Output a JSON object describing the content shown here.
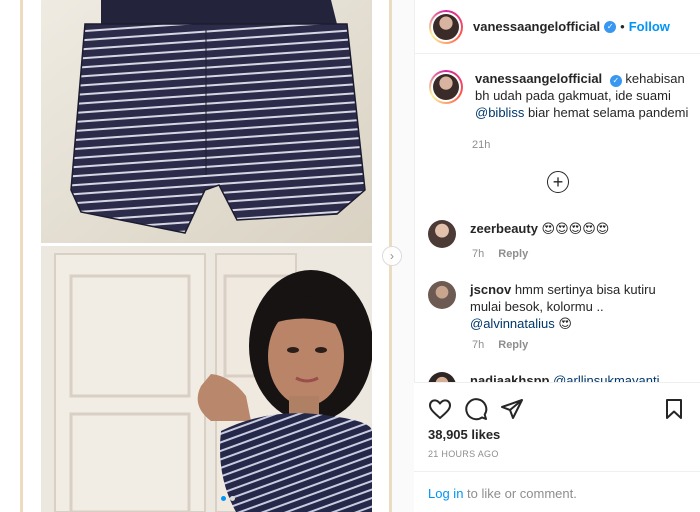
{
  "post": {
    "username": "vanessaangelofficial",
    "separator": "•",
    "follow_label": "Follow",
    "verified_glyph": "✓"
  },
  "caption": {
    "username": "vanessaangelofficial",
    "text_part1": "kehabisan bh udah pada gakmuat, ide suami",
    "mention": "@bibliss",
    "text_part2": "biar hemat selama pandemi",
    "time": "21h"
  },
  "load_more_label": "+",
  "carousel": {
    "next_glyph": "›"
  },
  "comments": [
    {
      "username": "zeerbeauty",
      "text": "😍😍😍😍😍",
      "time": "7h",
      "reply": "Reply"
    },
    {
      "username": "jscnov",
      "text_part1": "hmm sertinya bisa kutiru mulai besok, kolormu ..",
      "mention": "@alvinnatalius",
      "text_part2": "😍",
      "time": "7h",
      "reply": "Reply"
    },
    {
      "username": "nadiaakhspp",
      "mention": "@arllinsukmayanti"
    }
  ],
  "stats": {
    "likes": "38,905 likes",
    "timestamp": "21 HOURS AGO"
  },
  "login": {
    "link": "Log in",
    "rest": "to like or comment."
  },
  "icons": [
    "heart-icon",
    "comment-icon",
    "share-icon",
    "bookmark-icon",
    "plus-circle-icon",
    "chevron-right-icon"
  ],
  "colors": {
    "accent": "#0095f6",
    "text": "#262626",
    "muted": "#8e8e8e",
    "stripe_navy": "#2c2c4a"
  }
}
